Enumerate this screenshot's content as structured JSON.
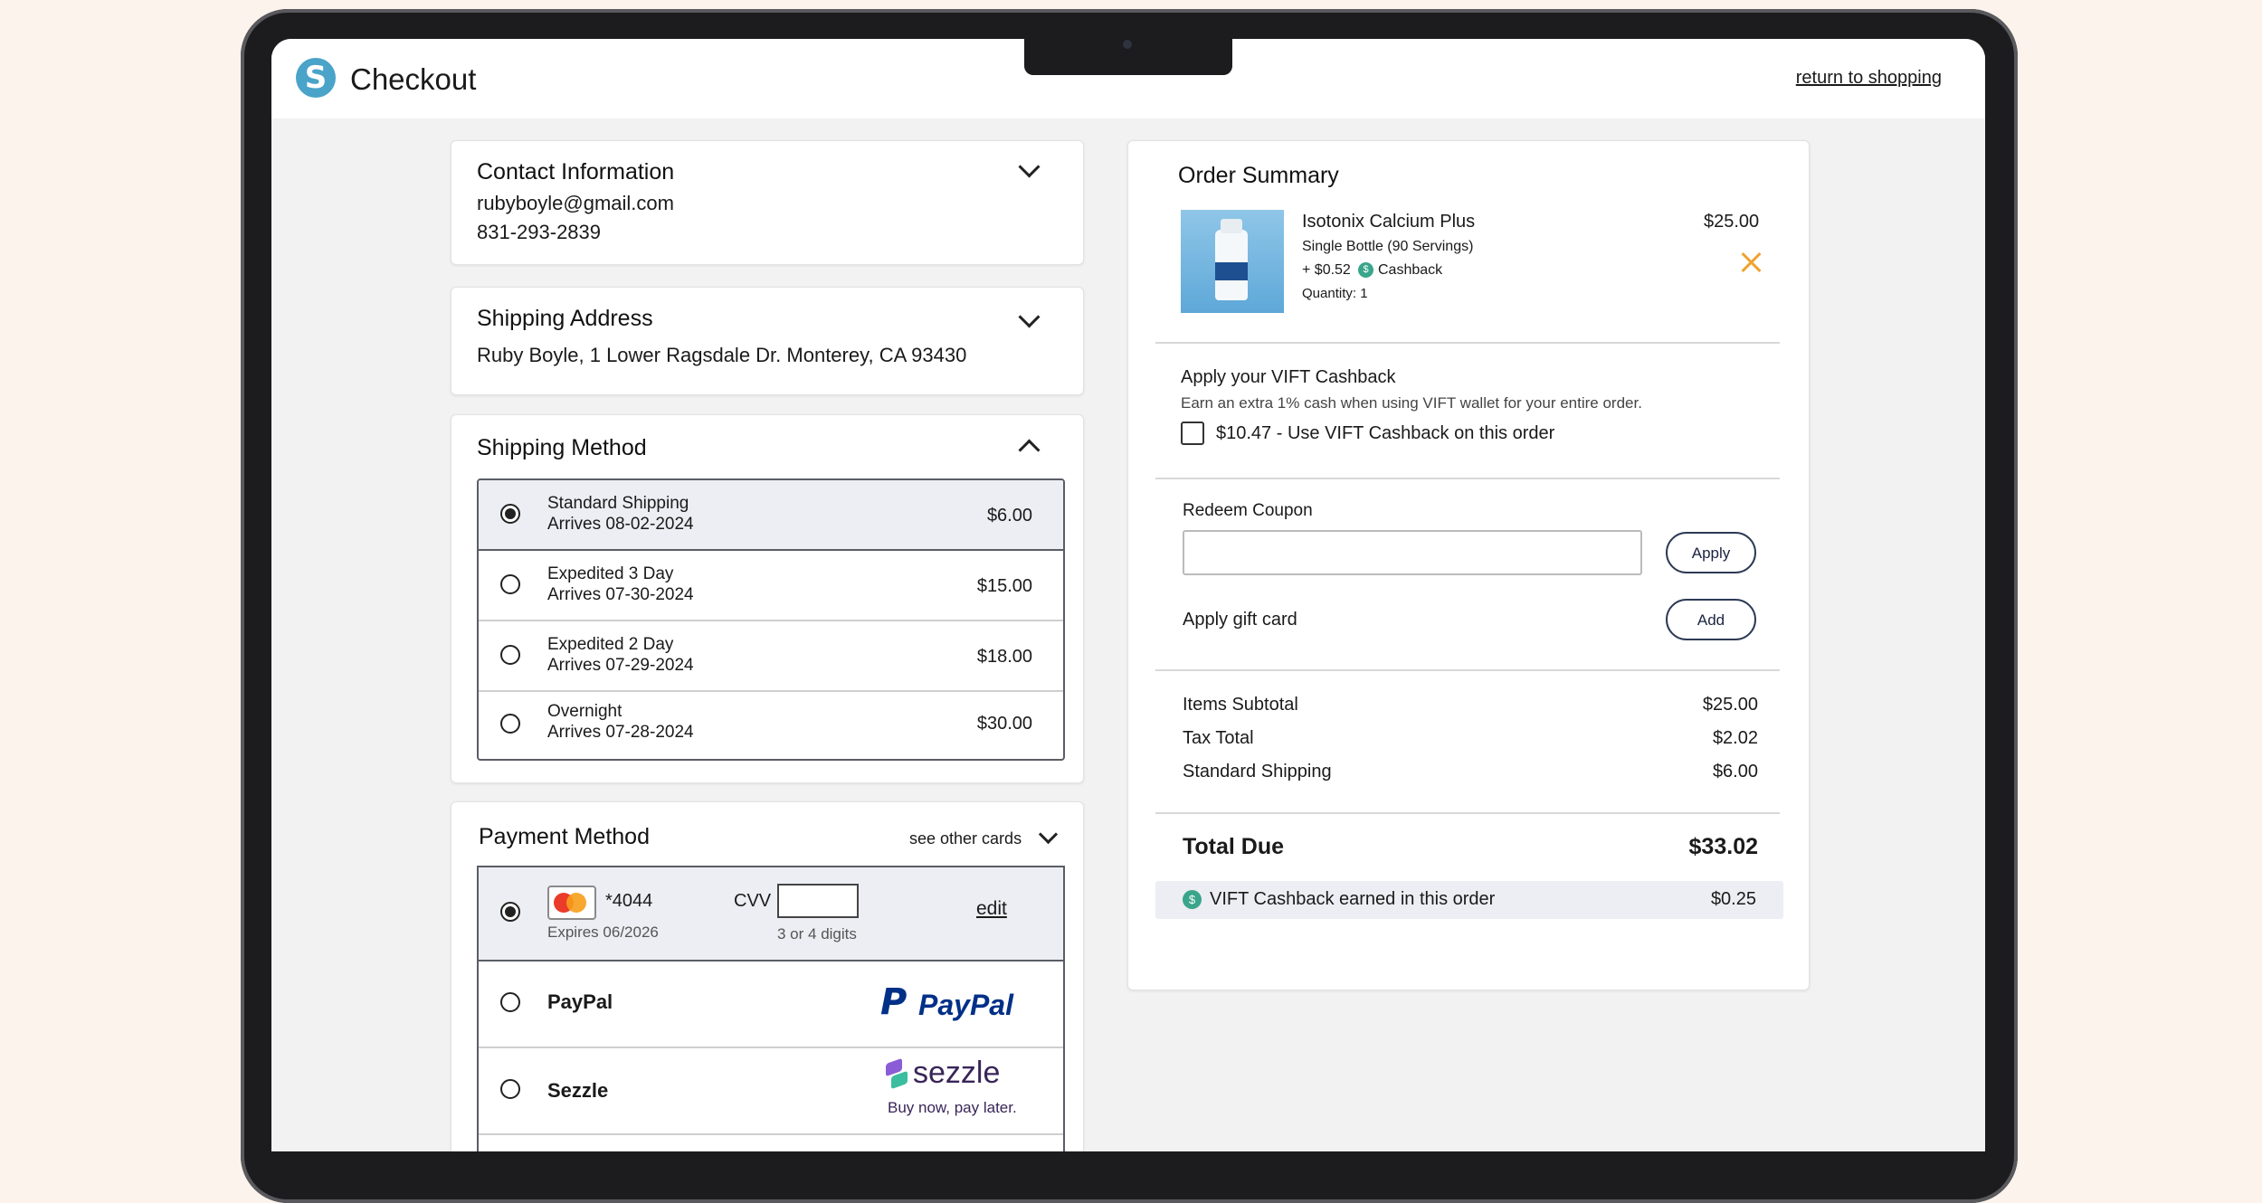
{
  "header": {
    "logo_letter": "S",
    "title": "Checkout",
    "return_link": "return to shopping"
  },
  "contact": {
    "title": "Contact Information",
    "email": "rubyboyle@gmail.com",
    "phone": "831-293-2839"
  },
  "shipping_address": {
    "title": "Shipping Address",
    "address": "Ruby Boyle, 1 Lower Ragsdale Dr. Monterey, CA 93430"
  },
  "shipping_method": {
    "title": "Shipping Method",
    "options": [
      {
        "name": "Standard Shipping",
        "arrives": "Arrives 08-02-2024",
        "price": "$6.00",
        "selected": true
      },
      {
        "name": "Expedited 3 Day",
        "arrives": "Arrives 07-30-2024",
        "price": "$15.00",
        "selected": false
      },
      {
        "name": "Expedited 2 Day",
        "arrives": "Arrives 07-29-2024",
        "price": "$18.00",
        "selected": false
      },
      {
        "name": "Overnight",
        "arrives": "Arrives 07-28-2024",
        "price": "$30.00",
        "selected": false
      }
    ]
  },
  "payment": {
    "title": "Payment Method",
    "see_other": "see other cards",
    "card_number": "*4044",
    "card_expiry": "Expires 06/2026",
    "cvv_label": "CVV",
    "cvv_value": "",
    "cvv_hint": "3 or 4 digits",
    "edit_label": "edit",
    "paypal_label": "PayPal",
    "paypal_logo_text": "PayPal",
    "sezzle_label": "Sezzle",
    "sezzle_logo_text": "sezzle",
    "sezzle_tagline": "Buy now, pay later."
  },
  "order_summary": {
    "title": "Order Summary",
    "product": {
      "name": "Isotonix Calcium Plus",
      "variant": "Single Bottle (90 Servings)",
      "cashback_amount": "+ $0.52",
      "cashback_label": "Cashback",
      "quantity": "Quantity: 1",
      "price": "$25.00"
    },
    "vift": {
      "title": "Apply your VIFT Cashback",
      "description": "Earn an extra 1% cash when using VIFT wallet for your entire order.",
      "checkbox_label": "$10.47 - Use VIFT Cashback on this order",
      "checked": false
    },
    "coupon": {
      "label": "Redeem Coupon",
      "value": "",
      "apply_label": "Apply"
    },
    "gift_card": {
      "label": "Apply gift card",
      "add_label": "Add"
    },
    "totals": [
      {
        "label": "Items Subtotal",
        "value": "$25.00"
      },
      {
        "label": "Tax Total",
        "value": "$2.02"
      },
      {
        "label": "Standard Shipping",
        "value": "$6.00"
      }
    ],
    "total_due_label": "Total Due",
    "total_due_value": "$33.02",
    "earned_label": "VIFT Cashback earned in this order",
    "earned_value": "$0.25"
  },
  "colors": {
    "accent_blue": "#4aa3c9",
    "remove_orange": "#f0a22e",
    "paypal_dark": "#003087",
    "paypal_light": "#009cde",
    "cashback_green": "#3aa58b"
  }
}
